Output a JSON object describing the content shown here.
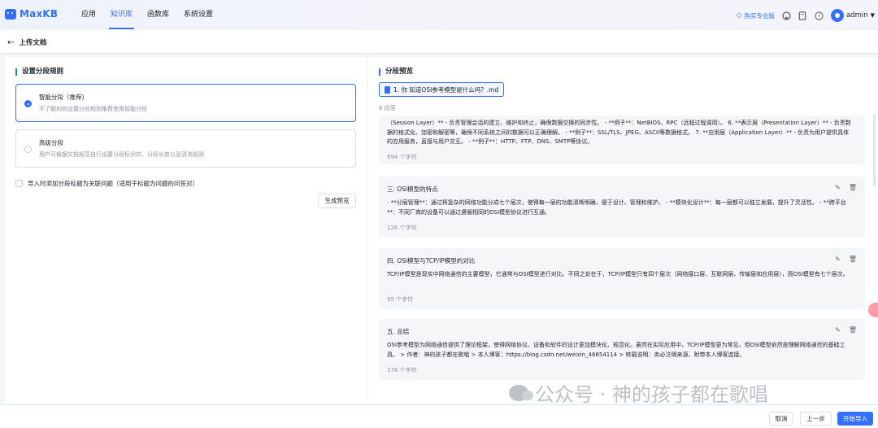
{
  "header": {
    "logo_text": "MaxKB",
    "nav": [
      "应用",
      "知识库",
      "函数库",
      "系统设置"
    ],
    "active_nav_index": 1,
    "upgrade_label": "购买专业版",
    "user_name": "admin",
    "icons": [
      "diamond-icon",
      "github-icon",
      "book-icon",
      "help-icon",
      "avatar-icon",
      "caret-down-icon"
    ]
  },
  "subheader": {
    "back_label": "上传文档",
    "back_icon": "arrow-left-icon"
  },
  "left": {
    "section_title": "设置分段规则",
    "option_smart": {
      "title": "智能分段（推荐)",
      "desc": "不了解如何设置分段规则推荐使用智能分段",
      "selected": true
    },
    "option_advanced": {
      "title": "高级分段",
      "desc": "用户可根据文档规范自行设置分段标识符、分段长度以及清洗规则",
      "selected": false
    },
    "checkbox_label": "导入时添加分段标题为关联问题（适用于标题为问题的问答对）",
    "preview_button": "生成预览"
  },
  "right": {
    "section_title": "分段预览",
    "file_name": "1. 你 知道OSI参考模型是什么吗？.md",
    "segment_count": "6 段落",
    "segments": [
      {
        "title": "",
        "content": "（Session Layer）** - 负责管理会话的建立、维护和终止，确保数据交换的同步性。 - **例子**：NetBIOS、RPC（远程过程调用）。 6. **表示层（Presentation Layer）** - 负责数据的格式化、加密和解密等，确保不同系统之间的数据可以正确理解。 - **例子**：SSL/TLS、JPEG、ASCII等数据格式。 7. **应用层（Application Layer）** - 负责为用户提供具体的应用服务，直接与用户交互。 - **例子**：HTTP、FTP、DNS、SMTP等协议。",
        "chars": "694 个字符"
      },
      {
        "title": "三. OSI模型的特点",
        "content": "- **分层管理**：通过将复杂的网络功能分成七个层次，使得每一层的功能清晰明确，便于设计、管理和维护。 - **模块化设计**：每一层都可以独立发展，提升了灵活性。 - **跨平台**：不同厂商的设备可以通过遵循相同的OSI模型协议进行互通。",
        "chars": "126 个字符"
      },
      {
        "title": "四. OSI模型与TCP/IP模型的对比",
        "content": "TCP/IP模型是现实中网络通信的主要模型，它通常与OSI模型进行对比。不同之处在于，TCP/IP模型只有四个层次（网络接口层、互联网层、传输层和应用层），而OSI模型有七个层次。",
        "chars": "95 个字符"
      },
      {
        "title": "五. 总结",
        "content": "OSI参考模型为网络通信提供了理论框架，使得网络协议、设备和软件的设计更加模块化、规范化。虽然在实际应用中，TCP/IP模型更为常见，但OSI模型依然是理解网络通信的基础工具。 > 作者：神的孩子都在歌唱 > 本人博客：https://blog.csdn.net/weixin_46654114 > 转载说明：务必注明来源，附带本人博客连接。",
        "chars": "176 个字符"
      }
    ],
    "edit_icon": "✎",
    "delete_icon": "🗑"
  },
  "footer": {
    "cancel": "取消",
    "prev": "上一步",
    "start_import": "开始导入"
  },
  "watermark": "公众号 · 神的孩子都在歌唱",
  "colors": {
    "accent": "#3370ff",
    "card_bg": "#f5f6f7"
  }
}
